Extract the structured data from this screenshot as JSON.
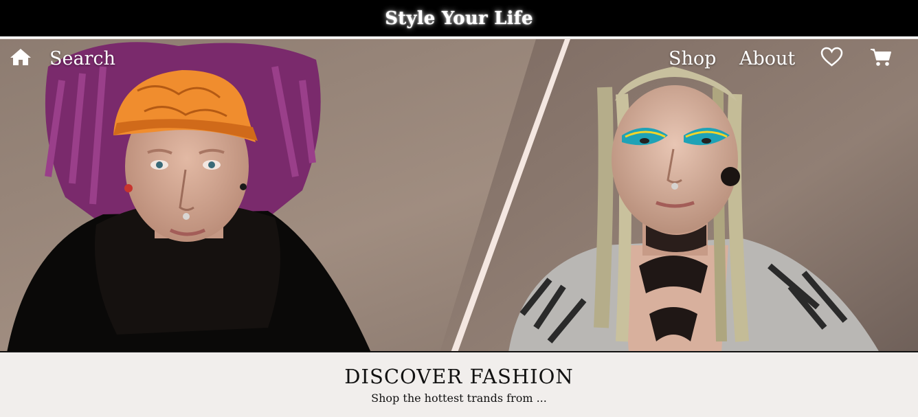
{
  "header": {
    "brand": "Style Your Life"
  },
  "nav": {
    "search_label": "Search",
    "shop_label": "Shop",
    "about_label": "About",
    "icons": {
      "home": "home-icon",
      "wishlist": "heart-icon",
      "cart": "cart-icon"
    }
  },
  "carousel": {
    "slide_count": 9,
    "active_index": 6
  },
  "promo": {
    "title": "DISCOVER FASHION",
    "subtitle": "Shop the hottest trands from ..."
  },
  "colors": {
    "banner_bg": "#000000",
    "nav_text": "#ffffff",
    "page_bg": "#f1eeec",
    "text_dark": "#111111"
  }
}
